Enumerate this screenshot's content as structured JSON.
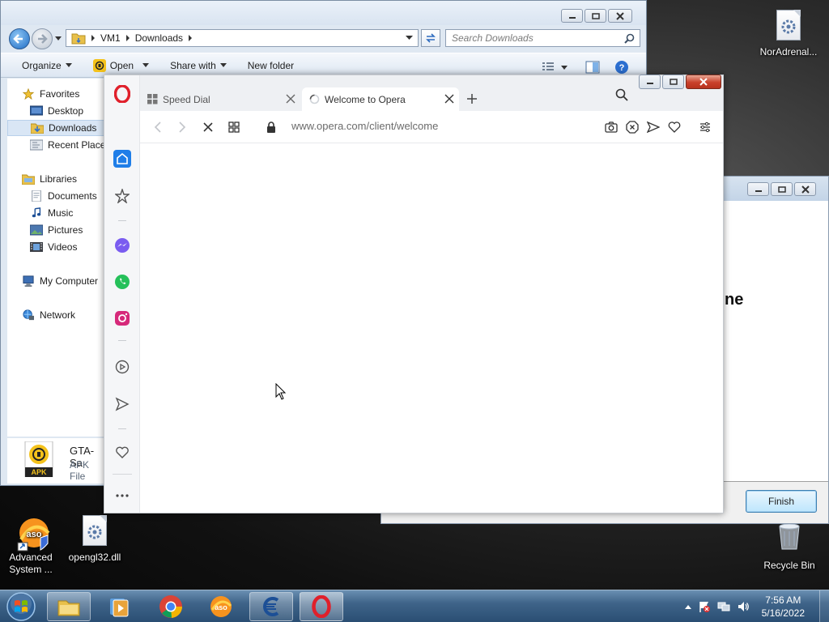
{
  "desktop": {
    "icons": [
      {
        "label": "NorAdrenal..."
      },
      {
        "label": "Advanced System ..."
      },
      {
        "label": "opengl32.dll"
      },
      {
        "label": "Recycle Bin"
      }
    ]
  },
  "explorer": {
    "breadcrumb": [
      "VM1",
      "Downloads"
    ],
    "search_placeholder": "Search Downloads",
    "commands": {
      "organize": "Organize",
      "open": "Open",
      "share": "Share with",
      "new_folder": "New folder"
    },
    "nav": {
      "favorites": "Favorites",
      "desktop": "Desktop",
      "downloads": "Downloads",
      "recent": "Recent Places",
      "libraries": "Libraries",
      "documents": "Documents",
      "music": "Music",
      "pictures": "Pictures",
      "videos": "Videos",
      "computer": "My Computer",
      "network": "Network"
    },
    "details": {
      "filename": "GTA-Sa",
      "filetype": "APK File",
      "icon_text": "APK"
    }
  },
  "opera": {
    "tabs": [
      {
        "label": "Speed Dial"
      },
      {
        "label": "Welcome to Opera"
      }
    ],
    "url": "www.opera.com/client/welcome"
  },
  "installer": {
    "heading_fragment": "ne",
    "finish_label": "Finish"
  },
  "taskbar": {
    "time": "7:56 AM",
    "date": "5/16/2022"
  },
  "colors": {
    "opera_red": "#e0202b",
    "accent_blue": "#0f7be0",
    "taskbar": "#3f6489"
  }
}
